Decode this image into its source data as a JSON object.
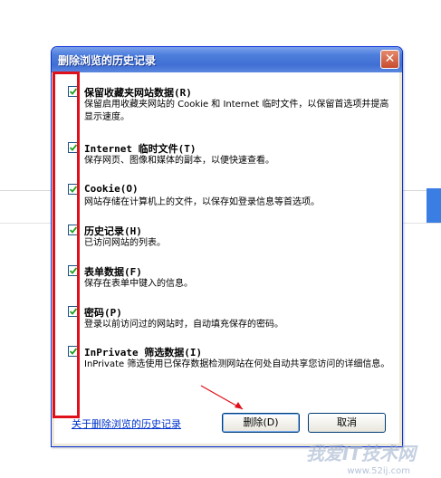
{
  "dialog": {
    "title": "删除浏览的历史记录",
    "close_glyph": "✕",
    "items": [
      {
        "label": "保留收藏夹网站数据(R)",
        "description": "保留启用收藏夹网站的 Cookie 和 Internet 临时文件，以保留首选项并提高显示速度。",
        "checked": true
      },
      {
        "label": "Internet 临时文件(T)",
        "description": "保存网页、图像和媒体的副本，以便快速查看。",
        "checked": true
      },
      {
        "label": "Cookie(O)",
        "description": "网站存储在计算机上的文件，以保存如登录信息等首选项。",
        "checked": true
      },
      {
        "label": "历史记录(H)",
        "description": "已访问网站的列表。",
        "checked": true
      },
      {
        "label": "表单数据(F)",
        "description": "保存在表单中键入的信息。",
        "checked": true
      },
      {
        "label": "密码(P)",
        "description": "登录以前访问过的网站时，自动填充保存的密码。",
        "checked": true
      },
      {
        "label": "InPrivate 筛选数据(I)",
        "description": "InPrivate 筛选使用已保存数据检测网站在何处自动共享您访问的详细信息。",
        "checked": true
      }
    ],
    "about_link": "关于删除浏览的历史记录",
    "delete_button": "删除(D)",
    "cancel_button": "取消"
  },
  "watermark": {
    "text": "我爱IT技术网",
    "url": "www.52ij.com"
  },
  "colors": {
    "annotation_red": "#e0101a",
    "titlebar_blue": "#3f6fd4",
    "check_green": "#21a121"
  }
}
